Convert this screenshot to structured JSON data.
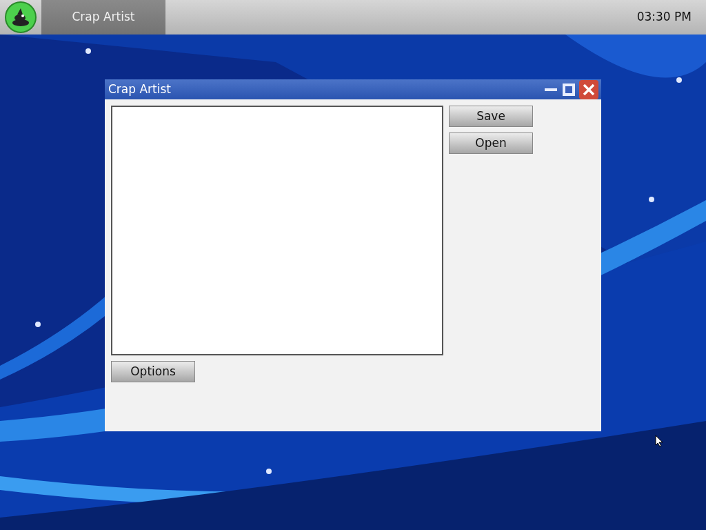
{
  "taskbar": {
    "tasks": [
      {
        "label": "Crap Artist",
        "selected": true
      }
    ],
    "clock": "03:30 PM"
  },
  "window": {
    "title": "Crap Artist",
    "side_buttons": [
      "Save",
      "Open"
    ],
    "bottom_button": "Options"
  }
}
